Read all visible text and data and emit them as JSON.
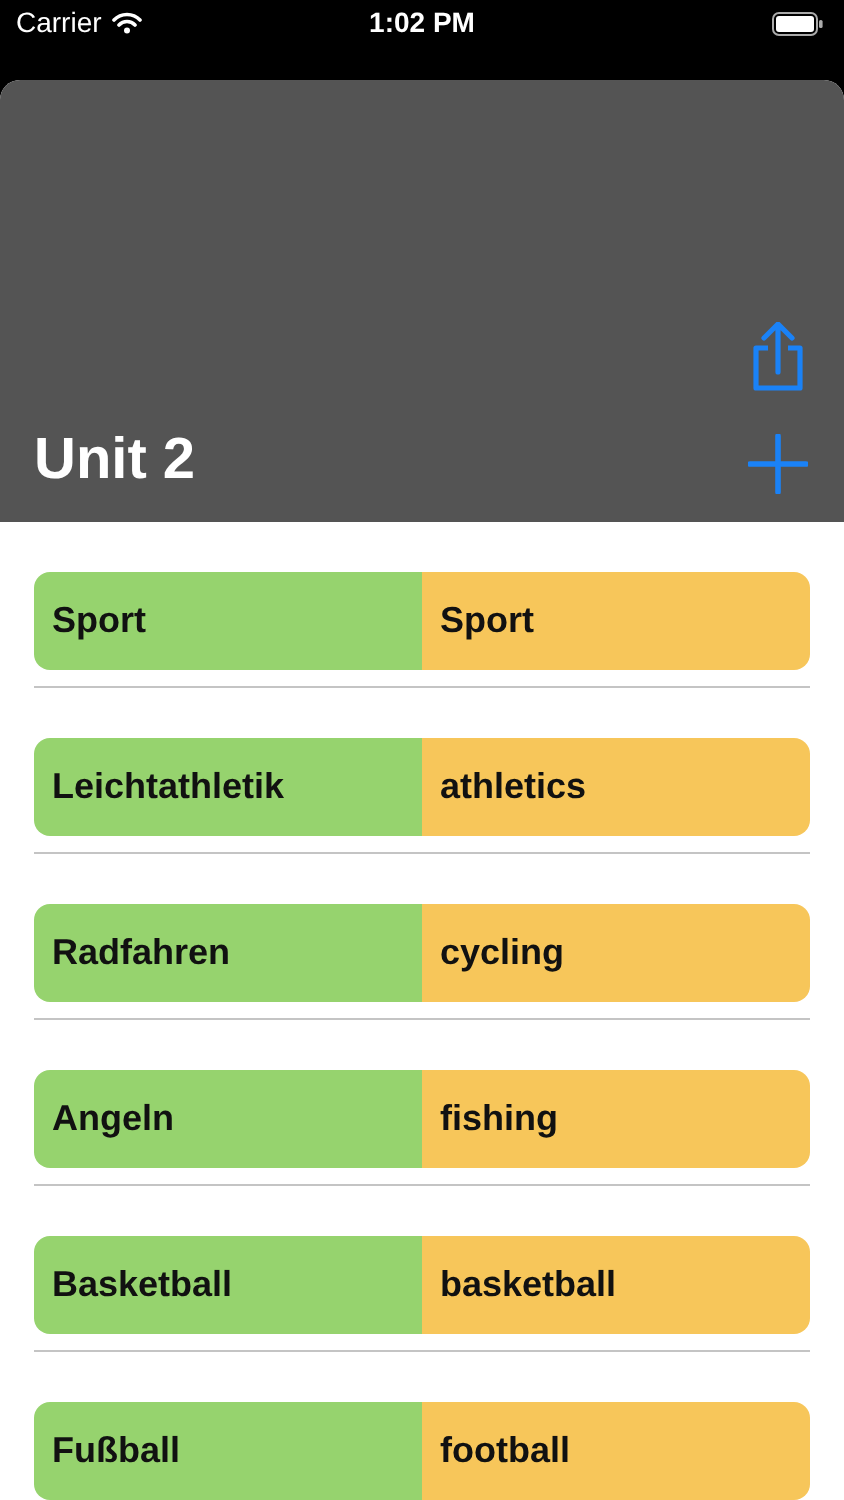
{
  "status_bar": {
    "carrier": "Carrier",
    "time": "1:02 PM"
  },
  "header": {
    "title": "Unit 2"
  },
  "words": [
    {
      "term": "Sport",
      "translation": "Sport"
    },
    {
      "term": "Leichtathletik",
      "translation": "athletics"
    },
    {
      "term": "Radfahren",
      "translation": "cycling"
    },
    {
      "term": "Angeln",
      "translation": "fishing"
    },
    {
      "term": "Basketball",
      "translation": "basketball"
    },
    {
      "term": "Fußball",
      "translation": "football"
    }
  ]
}
